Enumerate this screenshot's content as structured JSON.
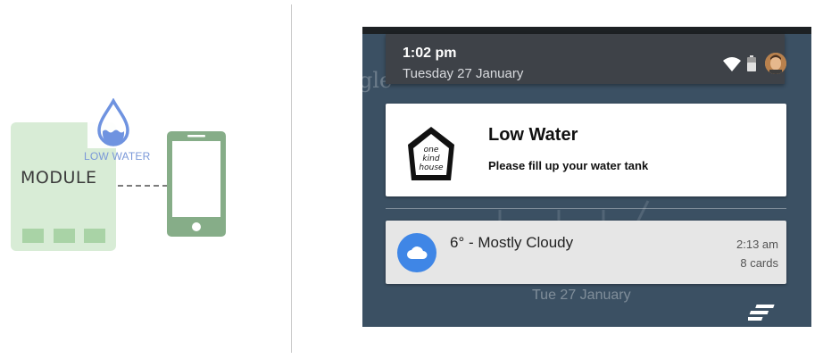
{
  "diagram": {
    "module_label": "MODULE",
    "low_water_label": "LOW WATER",
    "icons": [
      "water-drop-icon",
      "smartphone-icon"
    ],
    "colors": {
      "module_fill": "#d8ecd6",
      "slot_fill": "#a9d3a6",
      "drop": "#6f93e0",
      "phone": "#86ad88"
    }
  },
  "statusbar": {
    "time": "1:02 pm",
    "date": "Tuesday 27 January",
    "icons": [
      "wifi-icon",
      "battery-icon",
      "avatar"
    ]
  },
  "background": {
    "search_hint": "gle",
    "lockscreen_date": "Tue 27 January"
  },
  "notification": {
    "title": "Low Water",
    "body": "Please fill up your water tank",
    "app_icon": "one-kind-house-logo",
    "app_logo_text": "one kind house"
  },
  "weather_card": {
    "title": "6° - Mostly Cloudy",
    "time": "2:13 am",
    "cards": "8 cards",
    "icon": "cloud-icon",
    "accent": "#3f86e6"
  },
  "actions": {
    "dismiss_all_icon": "clear-all-icon"
  }
}
